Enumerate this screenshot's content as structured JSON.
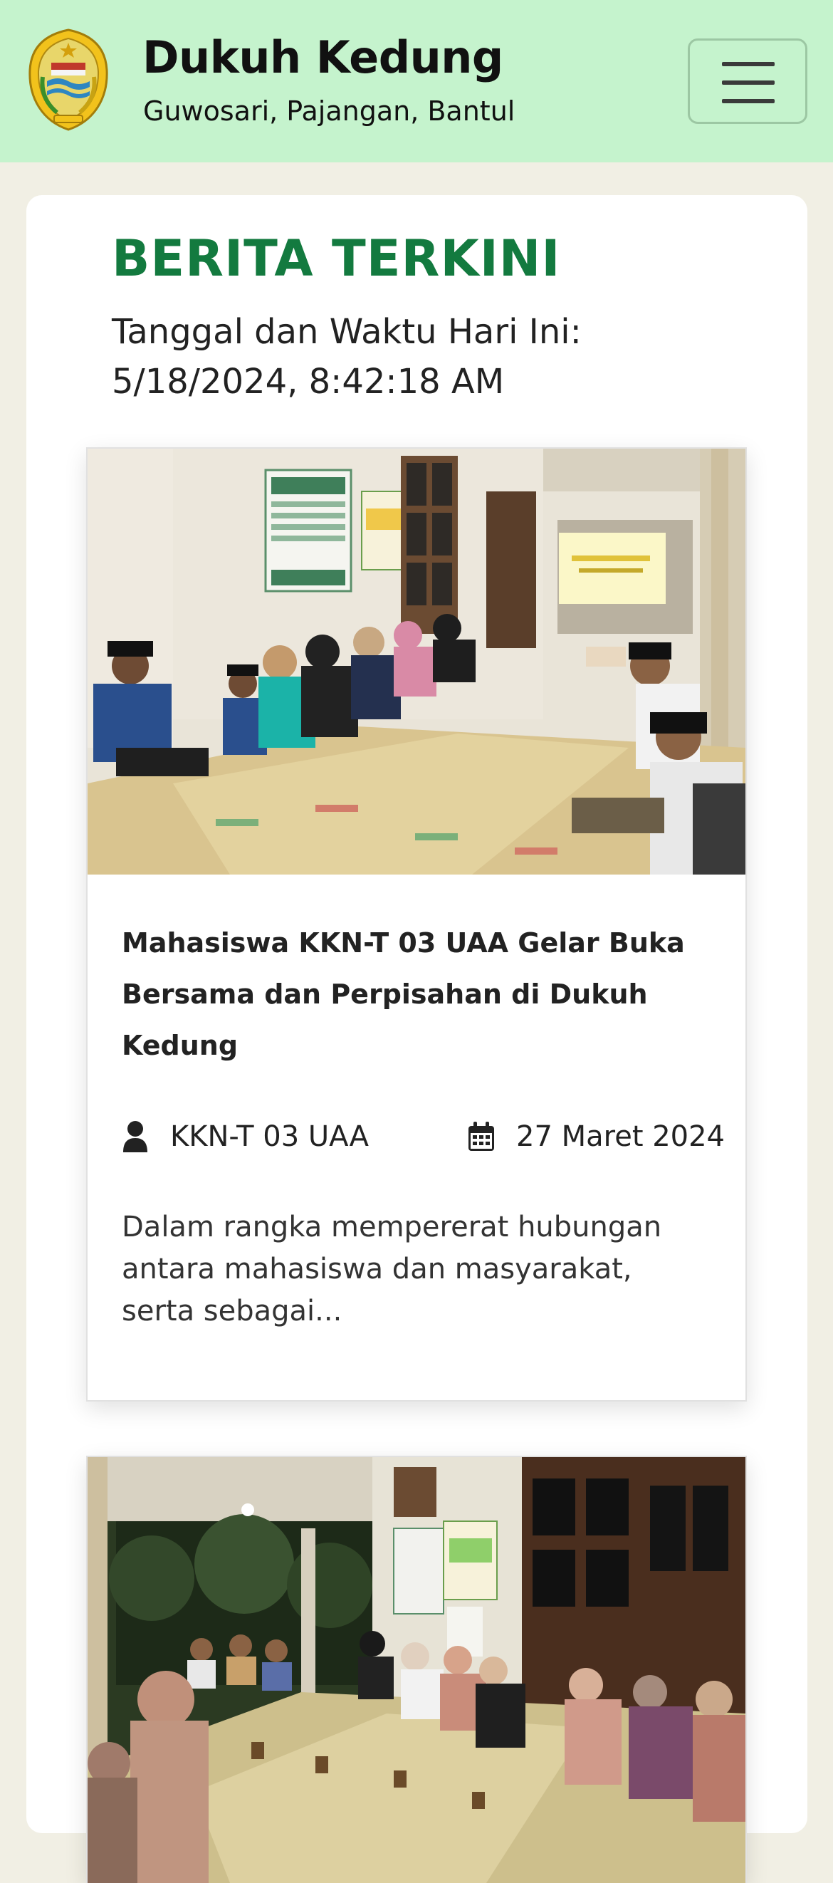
{
  "navbar": {
    "title": "Dukuh Kedung",
    "subtitle": "Guwosari, Pajangan, Bantul",
    "logo_icon": "bantul-seal-logo",
    "menu_icon": "hamburger-icon"
  },
  "main": {
    "section_title": "BERITA TERKINI",
    "datetime_label": "Tanggal dan Waktu Hari Ini:",
    "datetime_value": "5/18/2024, 8:42:18 AM"
  },
  "articles": [
    {
      "image": "photo-buka-bersama-indoor",
      "title": "Mahasiswa KKN-T 03 UAA Gelar Buka Bersama dan Perpisahan di Dukuh Kedung",
      "author": "KKN-T 03 UAA",
      "date": "27 Maret 2024",
      "excerpt": "Dalam rangka mempererat hubungan antara mahasiswa dan masyarakat, serta sebagai..."
    },
    {
      "image": "photo-gathering-evening"
    }
  ],
  "colors": {
    "navbar_bg": "#c5f3cd",
    "page_bg": "#f1efe4",
    "title_green": "#137a3f"
  }
}
